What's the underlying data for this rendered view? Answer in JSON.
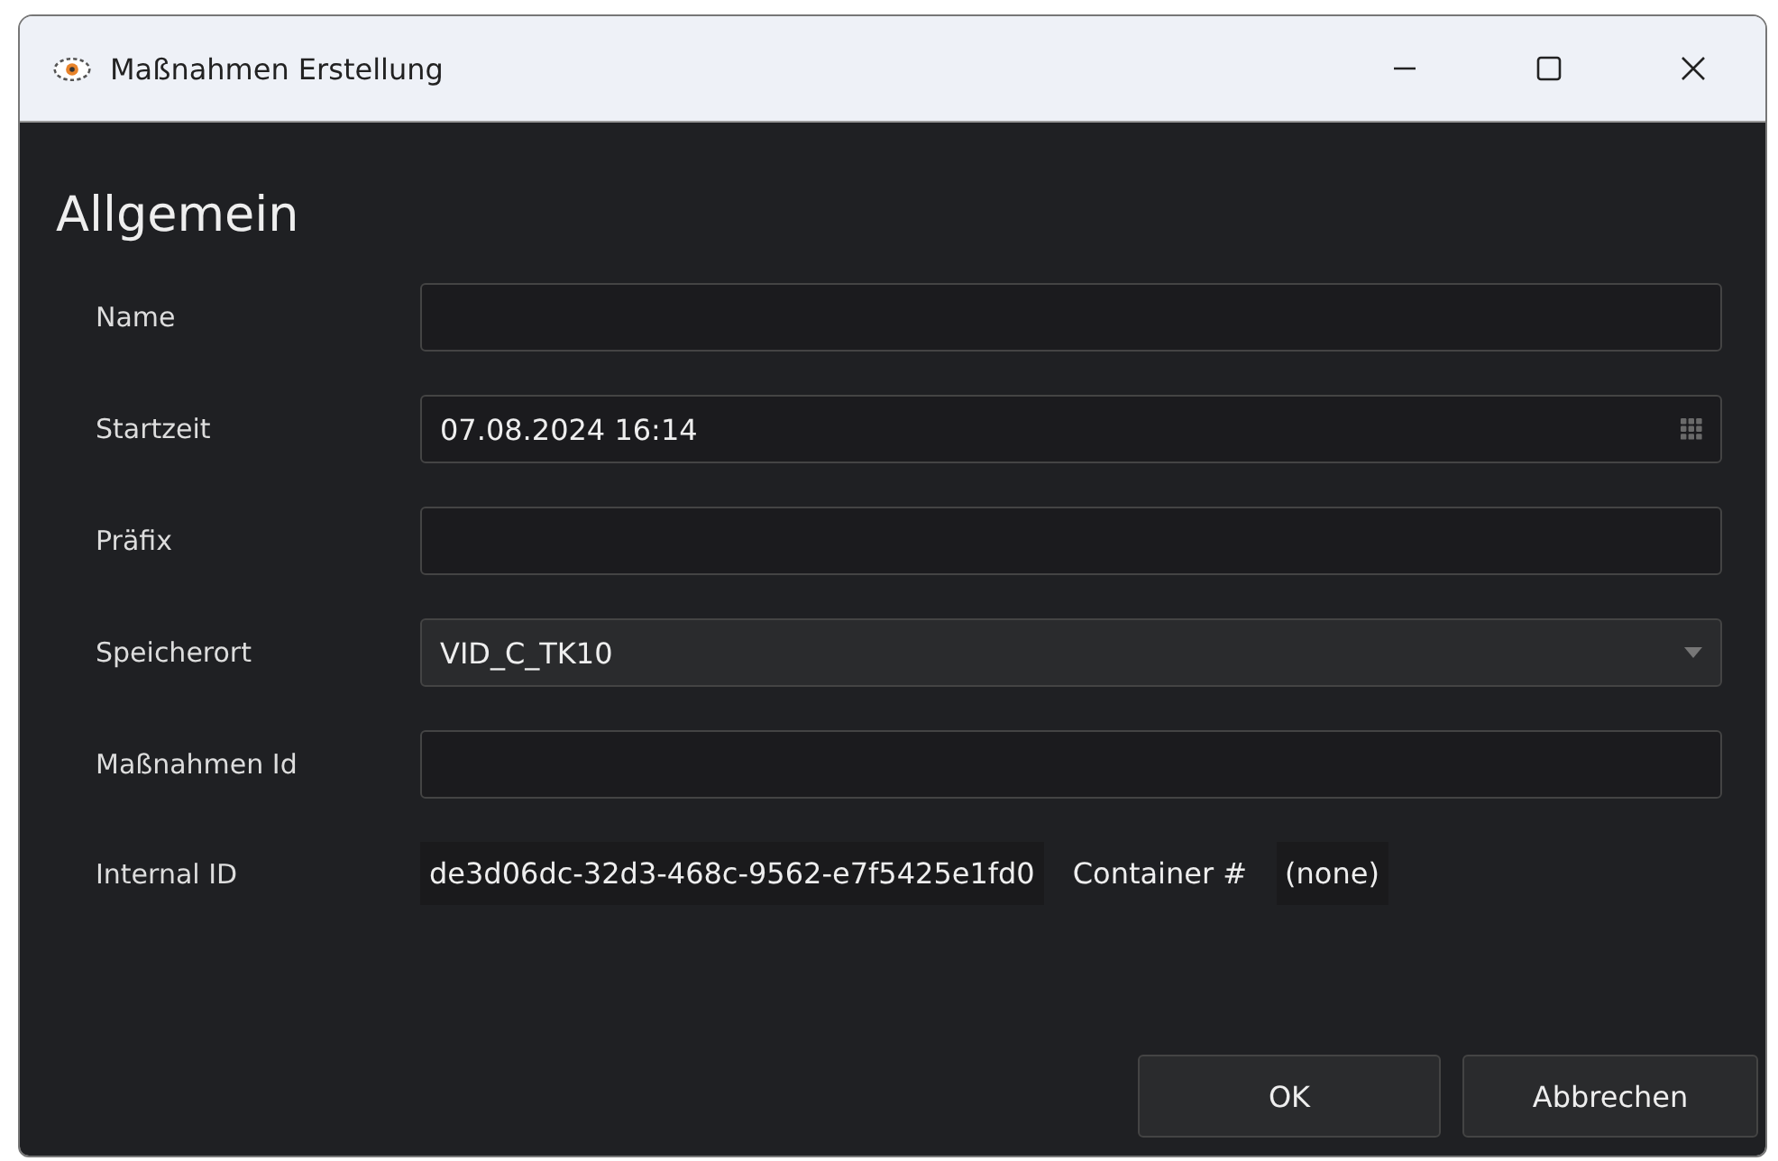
{
  "window": {
    "title": "Maßnahmen Erstellung"
  },
  "heading": "Allgemein",
  "fields": [
    {
      "label": "Name",
      "kind": "text"
    },
    {
      "label": "Startzeit",
      "kind": "datetime",
      "value": "07.08.2024 16:14"
    },
    {
      "label": "Präfix",
      "kind": "text"
    },
    {
      "label": "Speicherort",
      "kind": "dropdown",
      "value": "VID_C_TK10"
    },
    {
      "label": "Maßnahmen Id",
      "kind": "text"
    }
  ],
  "info": {
    "label": "Internal ID",
    "value": "de3d06dc-32d3-468c-9562-e7f5425e1fd0",
    "container_label": "Container #",
    "container_value": "(none)"
  },
  "buttons": [
    "OK",
    "Abbrechen"
  ]
}
